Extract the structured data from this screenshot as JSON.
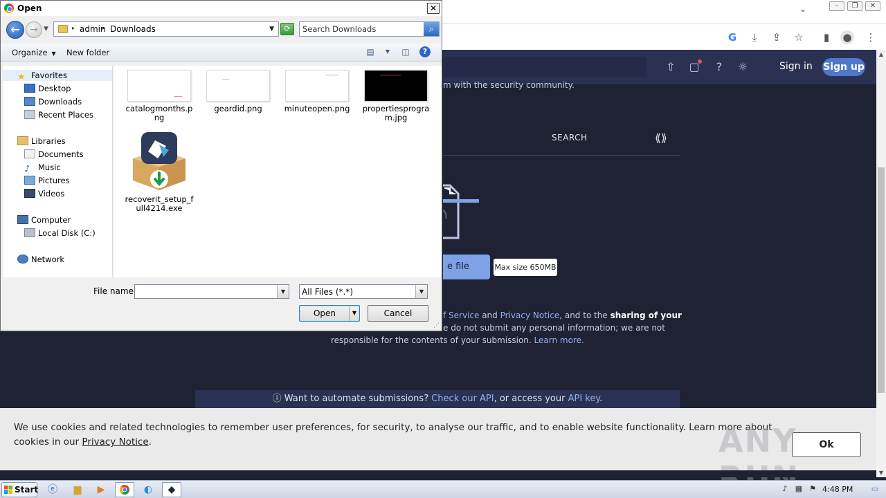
{
  "dialog": {
    "title": "Open",
    "close_glyph": "✕",
    "address": {
      "crumbs": [
        "admin",
        "Downloads"
      ]
    },
    "search_placeholder": "Search Downloads",
    "toolbar": {
      "organize": "Organize",
      "new_folder": "New folder",
      "help_glyph": "?"
    },
    "nav": {
      "favorites": "Favorites",
      "favorites_items": [
        "Desktop",
        "Downloads",
        "Recent Places"
      ],
      "libraries": "Libraries",
      "libraries_items": [
        "Documents",
        "Music",
        "Pictures",
        "Videos"
      ],
      "computer": "Computer",
      "computer_items": [
        "Local Disk (C:)"
      ],
      "network": "Network"
    },
    "files": [
      {
        "name": "catalogmonths.png",
        "thumb": "light"
      },
      {
        "name": "geardid.png",
        "thumb": "light"
      },
      {
        "name": "minuteopen.png",
        "thumb": "light"
      },
      {
        "name": "propertiesprogram.jpg",
        "thumb": "dark"
      },
      {
        "name": "recoverit_setup_full4214.exe",
        "thumb": "exe"
      }
    ],
    "file_name_label": "File name:",
    "file_name_value": "",
    "filter": "All Files (*.*)",
    "open_label": "Open",
    "cancel_label": "Cancel"
  },
  "browser": {
    "site": {
      "sign_in": "Sign in",
      "sign_up": "Sign up",
      "partial_line": "m with the security community.",
      "search_tab": "SEARCH",
      "upload_label": "e file",
      "max_size": "Max size 650MB",
      "terms_line1_a": "f Service",
      "terms_line1_b": " and ",
      "terms_line1_c": "Privacy Notice",
      "terms_line1_d": ", and to the ",
      "terms_line1_e": "sharing of your",
      "terms_line2": "e do not submit any personal information; we are not",
      "terms_line3_a": "responsible for the contents of your submission. ",
      "terms_line3_b": "Learn more.",
      "api_a": "Want to automate submissions? ",
      "api_b": "Check our API",
      "api_c": ", or access your ",
      "api_d": "API key",
      "api_e": "."
    },
    "cookie": {
      "text": "We use cookies and related technologies to remember user preferences, for security, to analyse our traffic, and to enable website functionality. Learn more about cookies in our ",
      "link": "Privacy Notice",
      "after": ".",
      "ok": "Ok"
    },
    "watermark": "ANY RUN"
  },
  "taskbar": {
    "start": "Start",
    "time": "4:48 PM"
  }
}
